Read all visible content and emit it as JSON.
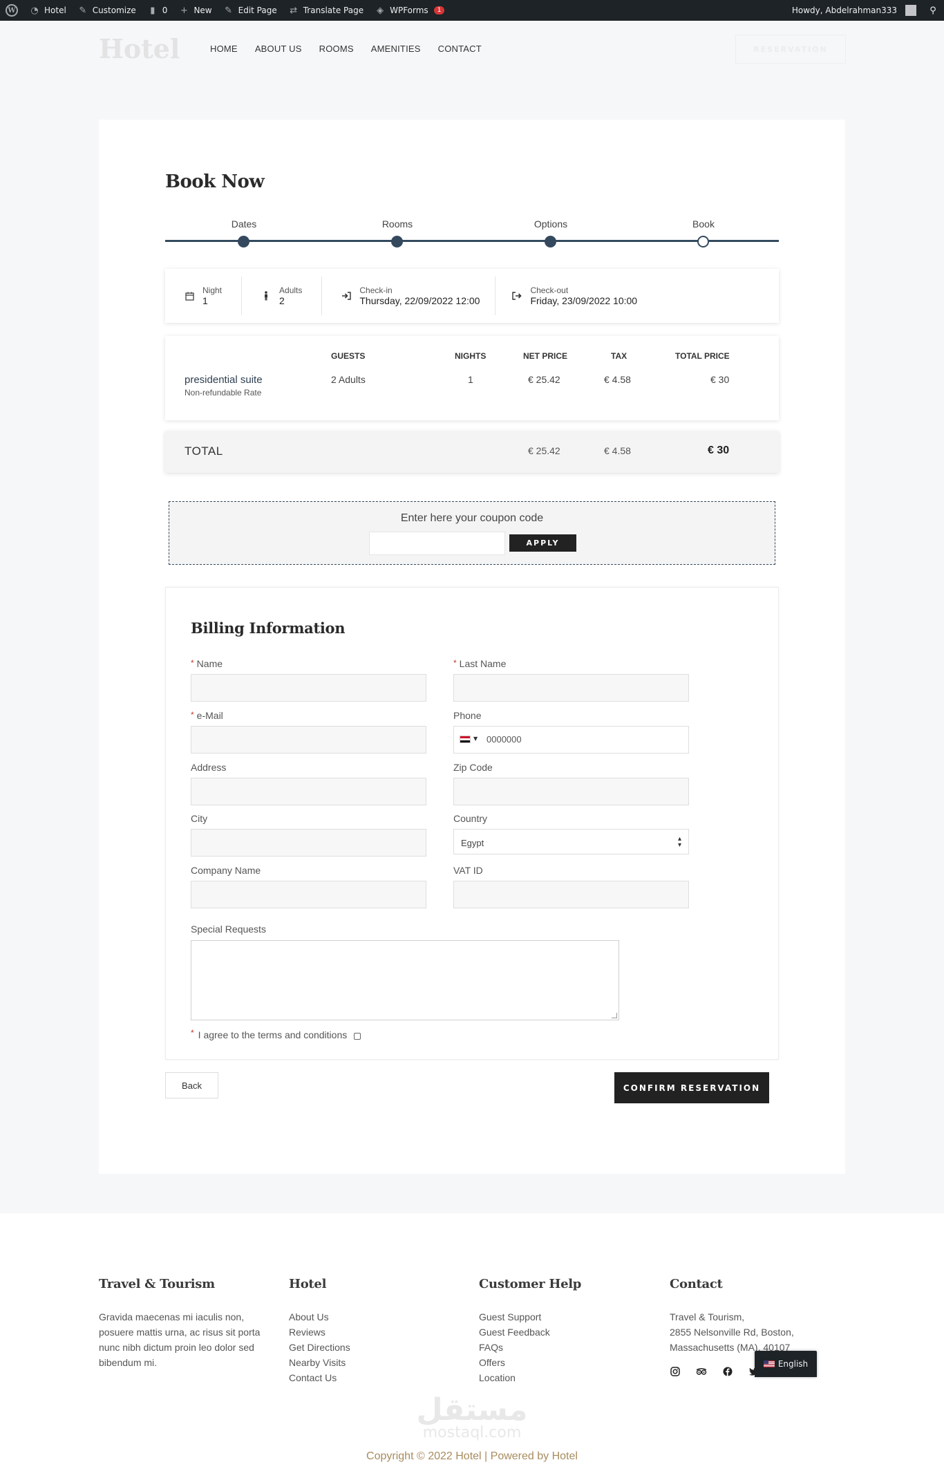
{
  "adminbar": {
    "site": "Hotel",
    "customize": "Customize",
    "comments": "0",
    "new": "New",
    "edit_page": "Edit Page",
    "translate": "Translate Page",
    "wpforms": "WPForms",
    "wpforms_badge": "1",
    "howdy": "Howdy, Abdelrahman333"
  },
  "header": {
    "logo": "Hotel",
    "nav": [
      "HOME",
      "ABOUT US",
      "ROOMS",
      "AMENITIES",
      "CONTACT"
    ],
    "reservation_btn": "RESERVATION"
  },
  "booking": {
    "title": "Book Now",
    "steps": [
      {
        "label": "Dates",
        "done": true
      },
      {
        "label": "Rooms",
        "done": true
      },
      {
        "label": "Options",
        "done": true
      },
      {
        "label": "Book",
        "done": false
      }
    ],
    "summary": {
      "night_label": "Night",
      "night_value": "1",
      "adults_label": "Adults",
      "adults_value": "2",
      "checkin_label": "Check-in",
      "checkin_value": "Thursday, 22/09/2022 12:00",
      "checkout_label": "Check-out",
      "checkout_value": "Friday, 23/09/2022 10:00"
    },
    "table": {
      "headers": {
        "guests": "GUESTS",
        "nights": "NIGHTS",
        "net": "NET PRICE",
        "tax": "TAX",
        "total": "TOTAL PRICE"
      },
      "room": {
        "name": "presidential suite",
        "rate": "Non-refundable Rate",
        "guests": "2 Adults",
        "nights": "1",
        "net": "€ 25.42",
        "tax": "€ 4.58",
        "total": "€ 30"
      }
    },
    "total": {
      "label": "TOTAL",
      "net": "€ 25.42",
      "tax": "€ 4.58",
      "total": "€ 30"
    },
    "coupon": {
      "title": "Enter here your coupon code",
      "apply": "APPLY"
    }
  },
  "billing": {
    "title": "Billing Information",
    "name": "Name",
    "last_name": "Last Name",
    "email": "e-Mail",
    "phone": "Phone",
    "phone_value": "0000000",
    "address": "Address",
    "zip": "Zip Code",
    "city": "City",
    "country": "Country",
    "country_value": "Egypt",
    "company": "Company Name",
    "vat": "VAT ID",
    "requests": "Special Requests",
    "terms": "I agree to the terms and conditions",
    "required_mark": "*"
  },
  "actions": {
    "back": "Back",
    "confirm": "CONFIRM RESERVATION"
  },
  "footer": {
    "col1": {
      "title": "Travel & Tourism",
      "text": "Gravida maecenas mi iaculis non, posuere mattis urna, ac risus sit porta nunc nibh dictum proin leo dolor sed bibendum mi."
    },
    "col2": {
      "title": "Hotel",
      "links": [
        "About Us",
        "Reviews",
        "Get Directions",
        "Nearby Visits",
        "Contact Us"
      ]
    },
    "col3": {
      "title": "Customer Help",
      "links": [
        "Guest Support",
        "Guest Feedback",
        "FAQs",
        "Offers",
        "Location"
      ]
    },
    "col4": {
      "title": "Contact",
      "lines": [
        "Travel & Tourism,",
        "2855 Nelsonville Rd, Boston,",
        "Massachusetts (MA), 40107"
      ]
    },
    "watermark_ar": "مستقل",
    "watermark_en": "mostaql.com",
    "copyright": "Copyright © 2022 Hotel | Powered by Hotel",
    "language": "English"
  },
  "colors": {
    "accent": "#34495e",
    "dark": "#222222",
    "gold": "#a88c5e",
    "page_bg": "#f6f7f9"
  }
}
